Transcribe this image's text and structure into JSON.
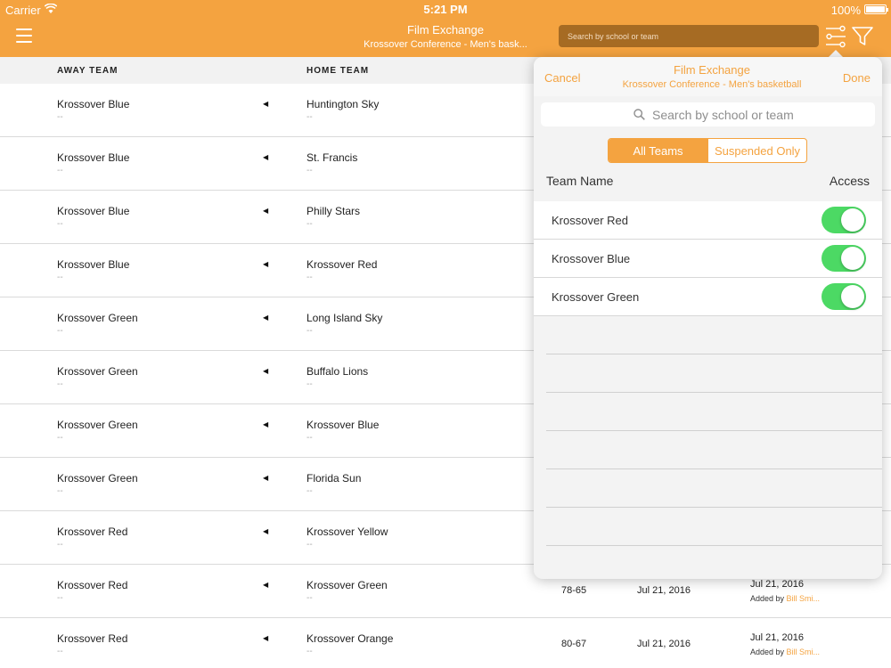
{
  "status_bar": {
    "carrier": "Carrier",
    "time": "5:21 PM",
    "battery": "100%"
  },
  "nav": {
    "title": "Film Exchange",
    "subtitle": "Krossover Conference - Men's bask...",
    "search_placeholder": "Search by school or team"
  },
  "table": {
    "columns": {
      "away": "AWAY TEAM",
      "home": "HOME TEAM"
    },
    "rows": [
      {
        "away": "Krossover Blue",
        "away_sub": "--",
        "home": "Huntington Sky",
        "home_sub": "--",
        "score": "",
        "date": "",
        "added_date": "",
        "added_by_prefix": "",
        "added_by_name": ""
      },
      {
        "away": "Krossover Blue",
        "away_sub": "--",
        "home": "St. Francis",
        "home_sub": "--",
        "score": "",
        "date": "",
        "added_date": "",
        "added_by_prefix": "",
        "added_by_name": ""
      },
      {
        "away": "Krossover Blue",
        "away_sub": "--",
        "home": "Philly Stars",
        "home_sub": "--",
        "score": "",
        "date": "",
        "added_date": "",
        "added_by_prefix": "",
        "added_by_name": ""
      },
      {
        "away": "Krossover Blue",
        "away_sub": "--",
        "home": "Krossover Red",
        "home_sub": "--",
        "score": "",
        "date": "",
        "added_date": "",
        "added_by_prefix": "",
        "added_by_name": ""
      },
      {
        "away": "Krossover Green",
        "away_sub": "--",
        "home": "Long Island Sky",
        "home_sub": "--",
        "score": "",
        "date": "",
        "added_date": "",
        "added_by_prefix": "",
        "added_by_name": ""
      },
      {
        "away": "Krossover Green",
        "away_sub": "--",
        "home": "Buffalo Lions",
        "home_sub": "--",
        "score": "",
        "date": "",
        "added_date": "",
        "added_by_prefix": "",
        "added_by_name": ""
      },
      {
        "away": "Krossover Green",
        "away_sub": "--",
        "home": "Krossover Blue",
        "home_sub": "--",
        "score": "",
        "date": "",
        "added_date": "",
        "added_by_prefix": "",
        "added_by_name": ""
      },
      {
        "away": "Krossover Green",
        "away_sub": "--",
        "home": "Florida Sun",
        "home_sub": "--",
        "score": "",
        "date": "",
        "added_date": "",
        "added_by_prefix": "",
        "added_by_name": ""
      },
      {
        "away": "Krossover Red",
        "away_sub": "--",
        "home": "Krossover Yellow",
        "home_sub": "--",
        "score": "",
        "date": "",
        "added_date": "",
        "added_by_prefix": "",
        "added_by_name": ""
      },
      {
        "away": "Krossover Red",
        "away_sub": "--",
        "home": "Krossover Green",
        "home_sub": "--",
        "score": "78-65",
        "date": "Jul 21, 2016",
        "added_date": "Jul 21, 2016",
        "added_by_prefix": "Added by ",
        "added_by_name": "Bill Smi..."
      },
      {
        "away": "Krossover Red",
        "away_sub": "--",
        "home": "Krossover Orange",
        "home_sub": "--",
        "score": "80-67",
        "date": "Jul 21, 2016",
        "added_date": "Jul 21, 2016",
        "added_by_prefix": "Added by ",
        "added_by_name": "Bill Smi..."
      }
    ]
  },
  "popover": {
    "cancel": "Cancel",
    "done": "Done",
    "title": "Film Exchange",
    "subtitle": "Krossover Conference - Men's basketball",
    "search_placeholder": "Search by school or team",
    "segments": {
      "all": "All Teams",
      "suspended": "Suspended Only"
    },
    "col_team_name": "Team Name",
    "col_access": "Access",
    "teams": [
      {
        "name": "Krossover Red",
        "access": true
      },
      {
        "name": "Krossover Blue",
        "access": true
      },
      {
        "name": "Krossover Green",
        "access": true
      }
    ]
  },
  "colors": {
    "accent": "#f4a340",
    "toggle_on": "#4cd964"
  },
  "icons": [
    "wifi-icon",
    "battery-icon",
    "menu-icon",
    "settings-sliders-icon",
    "filter-icon",
    "search-icon",
    "arrow-left-icon"
  ]
}
